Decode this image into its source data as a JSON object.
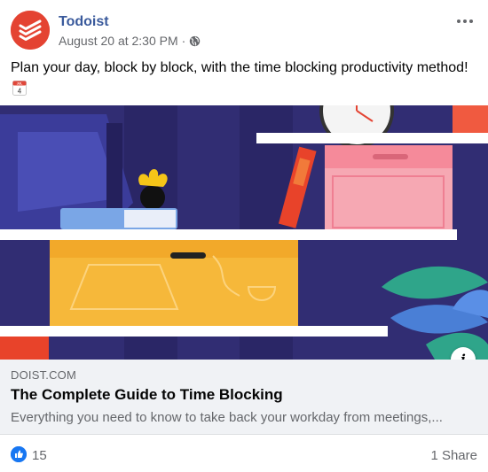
{
  "post": {
    "author": "Todoist",
    "timestamp": "August 20 at 2:30 PM",
    "separator": "·",
    "privacy_icon": "globe-icon",
    "caption": "Plan your day, block by block, with the time blocking productivity method!",
    "caption_emoji": "calendar-icon",
    "calendar_month": "JUL",
    "calendar_day": "4"
  },
  "link_preview": {
    "domain": "DOIST.COM",
    "title": "The Complete Guide to Time Blocking",
    "description": "Everything you need to know to take back your workday from meetings,..."
  },
  "reactions": {
    "like_count": "15",
    "shares": "1 Share"
  },
  "colors": {
    "brand": "#e44332",
    "link_name": "#3a5a9c",
    "like": "#1877f2",
    "illustration_bg": "#2e2a6e"
  }
}
